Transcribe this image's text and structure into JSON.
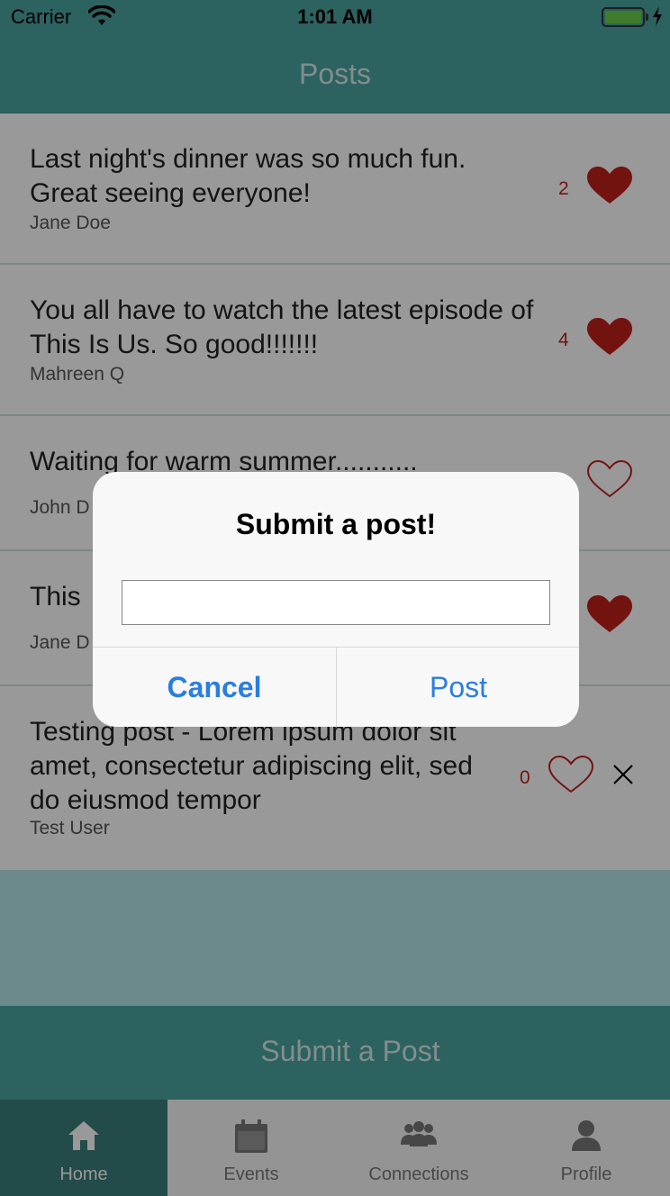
{
  "status_bar": {
    "carrier": "Carrier",
    "time": "1:01 AM"
  },
  "nav": {
    "title": "Posts"
  },
  "posts": [
    {
      "text": "Last night's dinner was so much fun. Great seeing everyone!",
      "author": "Jane Doe",
      "likes": "2",
      "liked": true
    },
    {
      "text": "You all have to watch the latest episode of This Is Us. So good!!!!!!!",
      "author": "Mahreen Q",
      "likes": "4",
      "liked": true
    },
    {
      "text": "Waiting for warm summer...........",
      "author": "John D",
      "likes": "",
      "liked": false
    },
    {
      "text": "This",
      "author": "Jane D",
      "likes": "",
      "liked": true
    },
    {
      "text": "Testing post - Lorem ipsum dolor sit amet, consectetur adipiscing elit, sed do eiusmod tempor",
      "author": "Test User",
      "likes": "0",
      "liked": false,
      "deletable": true
    }
  ],
  "submit_bar": {
    "label": "Submit a Post"
  },
  "tabs": [
    {
      "label": "Home",
      "icon": "home-icon",
      "active": true
    },
    {
      "label": "Events",
      "icon": "calendar-icon",
      "active": false
    },
    {
      "label": "Connections",
      "icon": "people-icon",
      "active": false
    },
    {
      "label": "Profile",
      "icon": "person-icon",
      "active": false
    }
  ],
  "dialog": {
    "title": "Submit a post!",
    "input_value": "",
    "cancel_label": "Cancel",
    "post_label": "Post"
  },
  "colors": {
    "accent": "#4aa3a0",
    "accent_dark": "#3a7d7a",
    "heart": "#c0201c",
    "ios_blue": "#2a7ee0"
  }
}
